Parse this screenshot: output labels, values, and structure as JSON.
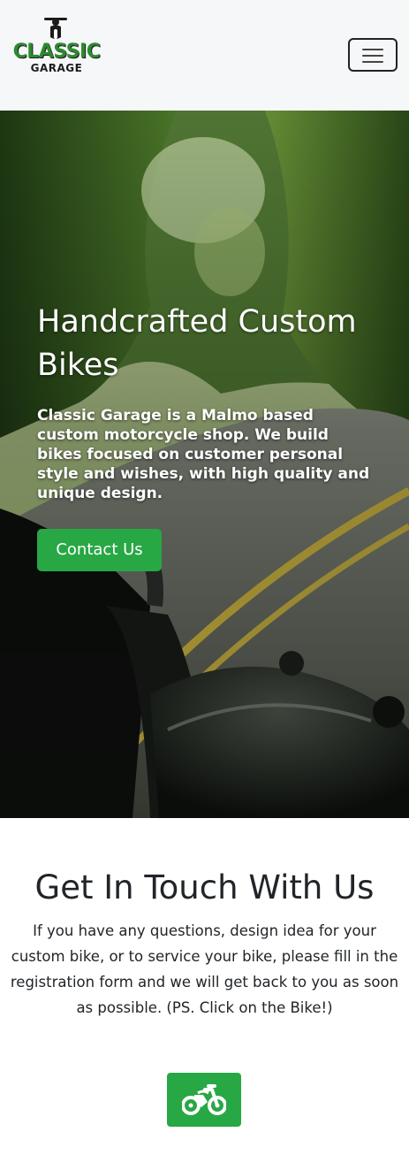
{
  "navbar": {
    "logo": {
      "line1": "CLASSIC",
      "line2": "GARAGE"
    },
    "menu_icon": "hamburger-icon"
  },
  "hero": {
    "title": "Handcrafted Custom Bikes",
    "text": "Classic Garage is a Malmo based custom motorcycle shop. We build bikes focused on customer personal style and wishes, with high quality and unique design.",
    "button_label": "Contact Us"
  },
  "contact": {
    "title": "Get In Touch With Us",
    "text": "If you have any questions, design idea for your custom bike, or to service your bike, please fill in the registration form and we will get back to you as soon as possible. (PS. Click on the Bike!)",
    "bike_icon": "motorcycle-icon"
  },
  "colors": {
    "accent": "#28a745",
    "logo_green": "#2e8a2f",
    "navbar_bg": "#f6f7f9",
    "text_dark": "#212529"
  }
}
